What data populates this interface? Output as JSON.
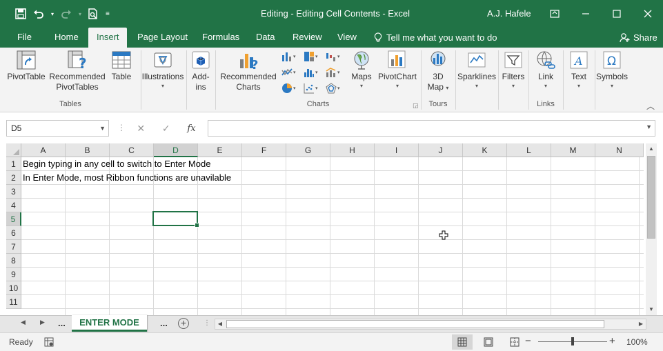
{
  "window": {
    "title": "Editing - Editing Cell Contents  -  Excel",
    "user": "A.J. Hafele",
    "accent_color": "#217346"
  },
  "qat": {
    "icons": [
      "save-icon",
      "undo-icon",
      "redo-icon",
      "print-preview-icon",
      "customize-qat-icon"
    ]
  },
  "tabs": [
    "File",
    "Home",
    "Insert",
    "Page Layout",
    "Formulas",
    "Data",
    "Review",
    "View"
  ],
  "active_tab": "Insert",
  "tell_me": "Tell me what you want to do",
  "share": "Share",
  "ribbon": {
    "groups": {
      "tables": "Tables",
      "charts": "Charts",
      "tours": "Tours",
      "links": "Links"
    },
    "buttons": {
      "pivottable": "PivotTable",
      "recommended_pivottables_1": "Recommended",
      "recommended_pivottables_2": "PivotTables",
      "table": "Table",
      "illustrations": "Illustrations",
      "addins_1": "Add-",
      "addins_2": "ins",
      "recommended_charts_1": "Recommended",
      "recommended_charts_2": "Charts",
      "maps": "Maps",
      "pivotchart": "PivotChart",
      "map3d_1": "3D",
      "map3d_2": "Map",
      "sparklines": "Sparklines",
      "filters": "Filters",
      "link": "Link",
      "text": "Text",
      "symbols": "Symbols"
    }
  },
  "formula_bar": {
    "name_box": "D5",
    "formula": ""
  },
  "grid": {
    "columns": [
      "A",
      "B",
      "C",
      "D",
      "E",
      "F",
      "G",
      "H",
      "I",
      "J",
      "K",
      "L",
      "M",
      "N"
    ],
    "selected_column": "D",
    "rows": [
      "1",
      "2",
      "3",
      "4",
      "5",
      "6",
      "7",
      "8",
      "9",
      "10",
      "11"
    ],
    "selected_row": "5",
    "cells": {
      "A1": "Begin typing in any cell to switch to Enter Mode",
      "A2": "In Enter Mode, most Ribbon functions are unavilable"
    }
  },
  "sheets": {
    "ellipsis_left": "...",
    "active": "ENTER MODE",
    "ellipsis_right": "..."
  },
  "status": {
    "mode": "Ready",
    "zoom": "100%"
  }
}
